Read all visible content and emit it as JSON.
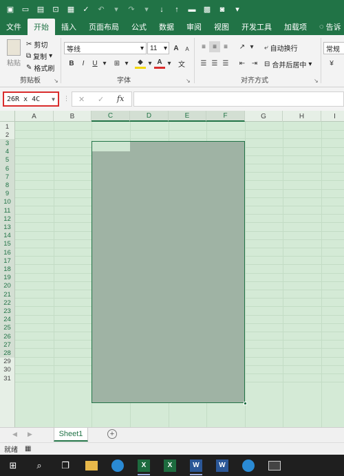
{
  "qat": {
    "undo": "↶",
    "redo": "↷"
  },
  "tabs": [
    "文件",
    "开始",
    "插入",
    "页面布局",
    "公式",
    "数据",
    "审阅",
    "视图",
    "开发工具",
    "加载项",
    "告诉"
  ],
  "ribbon": {
    "clipboard": {
      "paste": "粘贴",
      "cut": "剪切",
      "copy": "复制",
      "format_painter": "格式刷",
      "label": "剪贴板"
    },
    "font": {
      "name": "等线",
      "size": "11",
      "bold": "B",
      "italic": "I",
      "underline": "U",
      "grow": "A",
      "shrink": "A",
      "label": "字体"
    },
    "align": {
      "wrap": "自动换行",
      "merge": "合并后居中",
      "label": "对齐方式"
    },
    "number": {
      "format": "常规"
    }
  },
  "formula_bar": {
    "name_box": "26R x 4C",
    "cancel": "✕",
    "enter": "✓",
    "fx": "fx",
    "value": ""
  },
  "columns": [
    "A",
    "B",
    "C",
    "D",
    "E",
    "F",
    "G",
    "H",
    "I"
  ],
  "selected_columns": [
    "C",
    "D",
    "E",
    "F"
  ],
  "rows": [
    "1",
    "2",
    "3",
    "4",
    "5",
    "6",
    "7",
    "8",
    "9",
    "10",
    "11",
    "12",
    "13",
    "14",
    "15",
    "16",
    "17",
    "18",
    "19",
    "20",
    "21",
    "22",
    "23",
    "24",
    "25",
    "26",
    "27",
    "28",
    "29",
    "30",
    "31"
  ],
  "selected_rows_range": [
    3,
    28
  ],
  "sheets": [
    {
      "name": "Sheet1",
      "active": true
    }
  ],
  "status": {
    "ready": "就绪"
  },
  "colors": {
    "accent": "#217346",
    "grid_bg": "#d4ead6",
    "selection": "#9fb3a4",
    "namebox_highlight": "#d92b2b"
  }
}
